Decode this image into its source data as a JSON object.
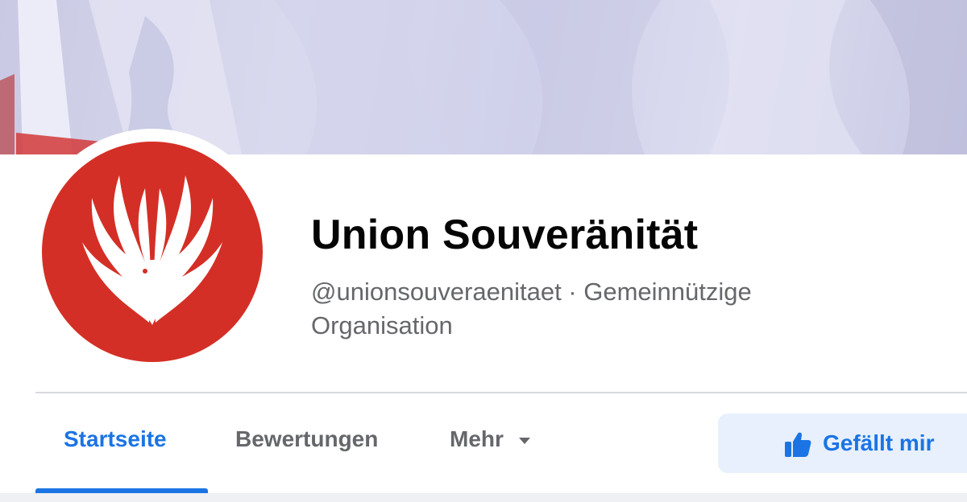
{
  "page": {
    "name": "Union Souveränität",
    "handle_category": "@unionsouveraenitaet · Gemeinnützige Organisation"
  },
  "tabs": [
    {
      "label": "Startseite",
      "active": true
    },
    {
      "label": "Bewertungen",
      "active": false
    },
    {
      "label": "Mehr",
      "active": false
    }
  ],
  "like_button": {
    "label": "Gefällt mir",
    "icon": "thumbs-up-icon"
  },
  "colors": {
    "accent": "#1b74e4",
    "avatar_red": "#d42f26",
    "secondary_text": "#65676b",
    "like_button_bg": "#e7f0fc"
  }
}
